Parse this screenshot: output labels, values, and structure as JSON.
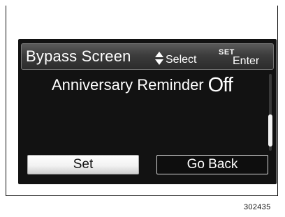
{
  "header": {
    "title": "Bypass Screen",
    "select_icon": "up-down-arrows-icon",
    "select_label": "Select",
    "enter_key": "SET",
    "enter_label": "Enter"
  },
  "option": {
    "label": "Anniversary Reminder",
    "value": "Off"
  },
  "buttons": {
    "set_label": "Set",
    "back_label": "Go Back"
  },
  "figure_id": "302435",
  "colors": {
    "screen_bg": "#121212",
    "text": "#ffffff",
    "selected_button_bg": "#f2f2f2"
  }
}
